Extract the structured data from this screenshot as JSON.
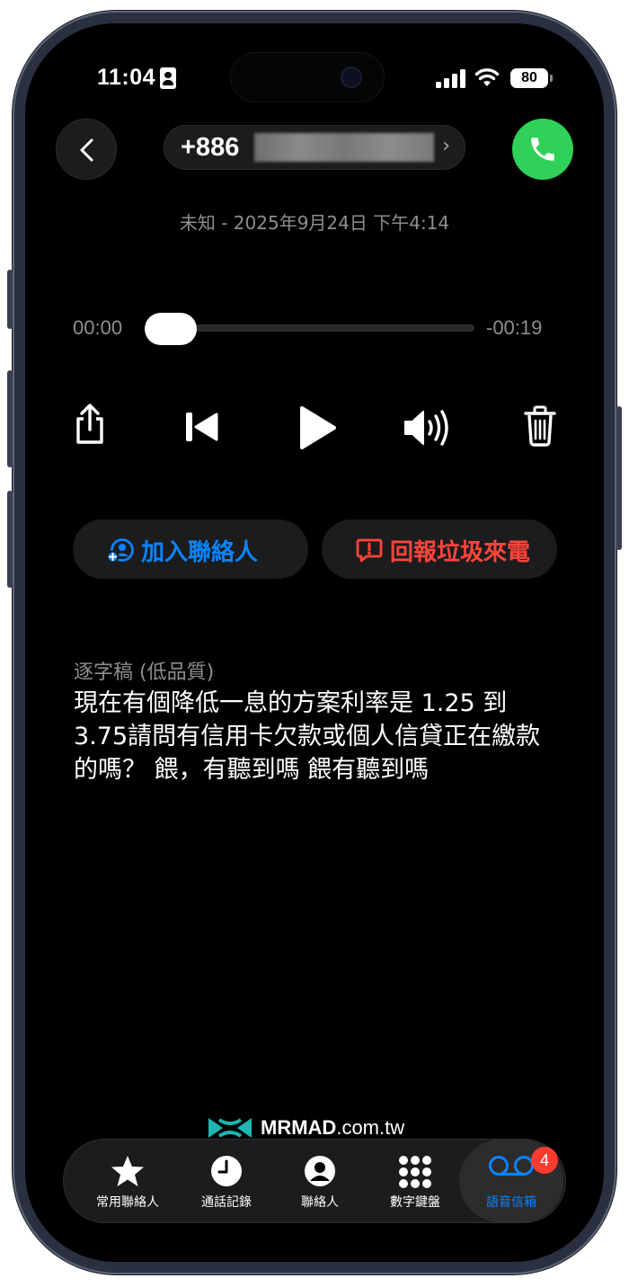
{
  "status_bar": {
    "time": "11:04",
    "battery": "80"
  },
  "header": {
    "number": "+886",
    "meta": "未知 - 2025年9月24日 下午4:14"
  },
  "player": {
    "elapsed": "00:00",
    "remaining": "-00:19",
    "progress": 0.0
  },
  "actions": {
    "add_contact": "加入聯絡人",
    "report_spam": "回報垃圾來電"
  },
  "transcript": {
    "label": "逐字稿 (低品質)",
    "text": "現在有個降低一息的方案利率是 1.25 到 3.75請問有信用卡欠款或個人信貸正在繳款的嗎？ 餵，有聽到嗎 餵有聽到嗎"
  },
  "watermark": {
    "brand": "MRMAD",
    "suffix": ".com.tw"
  },
  "tabs": [
    {
      "label": "常用聯絡人",
      "icon": "star-icon"
    },
    {
      "label": "通話記錄",
      "icon": "clock-icon"
    },
    {
      "label": "聯絡人",
      "icon": "person-circle-icon"
    },
    {
      "label": "數字鍵盤",
      "icon": "keypad-icon"
    },
    {
      "label": "語音信箱",
      "icon": "voicemail-icon",
      "badge": "4",
      "active": true
    }
  ],
  "colors": {
    "accent": "#0a84ff",
    "danger": "#ff453a",
    "call_green": "#30d158",
    "badge_red": "#ff3b30"
  }
}
